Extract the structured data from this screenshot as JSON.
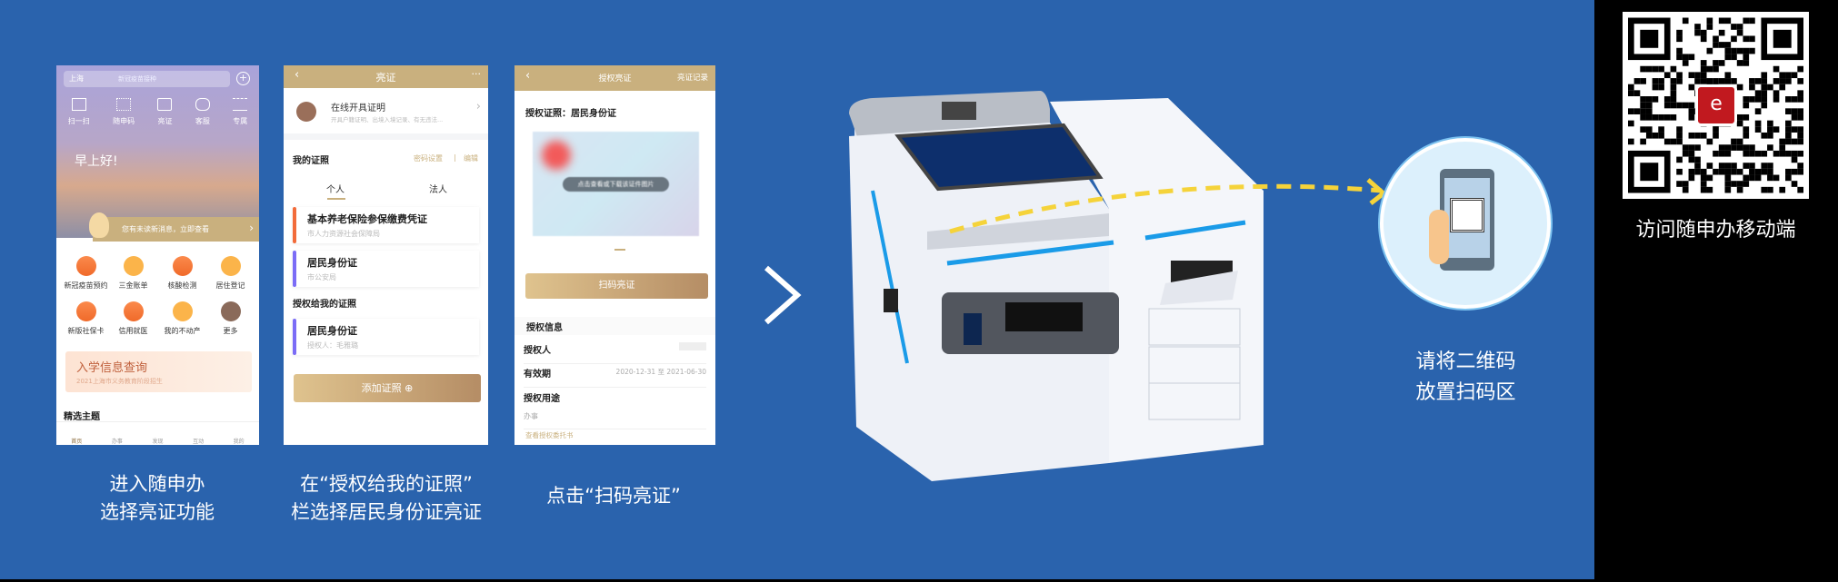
{
  "phone1": {
    "location": "上海",
    "search_placeholder": "新冠疫苗接种",
    "quick": [
      "扫一扫",
      "随申码",
      "亮证",
      "客服",
      "专属"
    ],
    "greeting": "早上好!",
    "notice": "您有未读新消息，立即查看",
    "grid": [
      "新冠疫苗预约",
      "三金账单",
      "核酸检测",
      "居住登记",
      "新版社保卡",
      "信用就医",
      "我的不动产",
      "更多"
    ],
    "promo_title": "入学信息查询",
    "promo_sub": "2021上海市义务教育阶段招生",
    "section": "精选主题",
    "tabs": [
      "首页",
      "办事",
      "发现",
      "互动",
      "我的"
    ]
  },
  "phone2": {
    "title": "亮证",
    "more": "···",
    "online_title": "在线开具证明",
    "online_sub": "开具户籍证明、出境入境记录、有无违法...",
    "my_certs": "我的证照",
    "pwd": "密码设置",
    "sep": "|",
    "edit": "编辑",
    "tab_personal": "个人",
    "tab_legal": "法人",
    "cards": [
      {
        "title": "基本养老保险参保缴费凭证",
        "sub": "市人力资源社会保障局",
        "color": "#f26b3a"
      },
      {
        "title": "居民身份证",
        "sub": "市公安局",
        "color": "#7b6cf6"
      }
    ],
    "authorized": "授权给我的证照",
    "auth_card": {
      "title": "居民身份证",
      "sub": "授权人：毛雅璐",
      "color": "#7b6cf6"
    },
    "add": "添加证照 ⊕"
  },
  "phone3": {
    "title": "授权亮证",
    "record": "亮证记录",
    "cert": "授权证照：居民身份证",
    "overlay": "点击查看或下载该证件图片",
    "scan": "扫码亮证",
    "info": "授权信息",
    "grantor": "授权人",
    "validity": "有效期",
    "validity_value": "2020-12-31 至 2021-06-30",
    "purpose": "授权用途",
    "purpose_value": "办事",
    "view": "查看授权委托书"
  },
  "captions": {
    "c1": [
      "进入随申办",
      "选择亮证功能"
    ],
    "c2": [
      "在“授权给我的证照”",
      "栏选择居民身份证亮证"
    ],
    "c3": "点击“扫码亮证”"
  },
  "scan_hint": [
    "请将二维码",
    "放置扫码区"
  ],
  "qr_caption": "访问随申办移动端",
  "colors": {
    "bg": "#2a63ad",
    "gold": "#c9b07e",
    "dash": "#f5d33a"
  }
}
